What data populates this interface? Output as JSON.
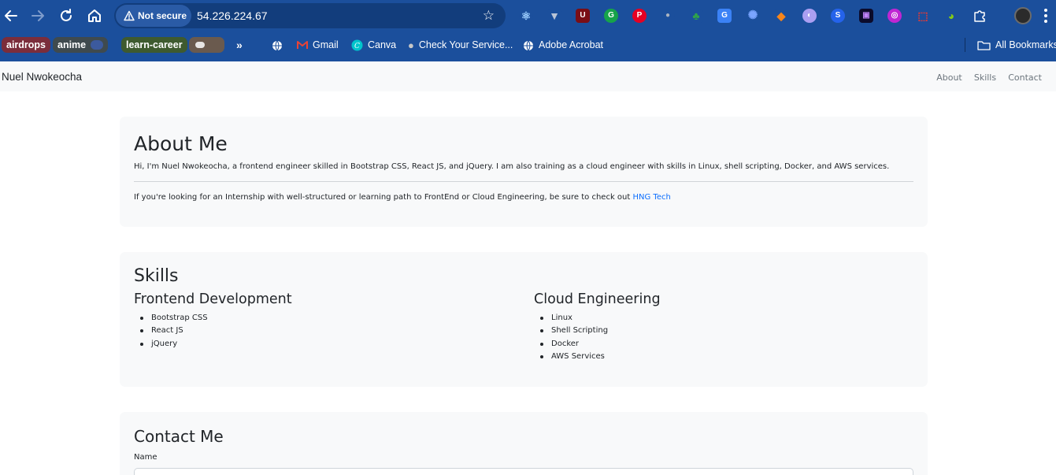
{
  "browser": {
    "address_bar": {
      "security_label": "Not secure",
      "url": "54.226.224.67"
    },
    "extensions": [
      "react-devtools-icon",
      "vuejs-icon",
      "ublock-icon",
      "grammarly-icon",
      "pinterest-icon",
      "rabby-icon",
      "bonsai-icon",
      "google-translate-icon",
      "gear-blue-icon",
      "metamask-icon",
      "phantom-icon",
      "sider-icon",
      "tab-icon",
      "magenta-icon",
      "pdf-icon",
      "earth-icon",
      "puzzle-icon"
    ],
    "bookmarks": [
      {
        "label": "airdrops",
        "type": "folder-chip",
        "color": "#7b2d3b"
      },
      {
        "label": "anime",
        "type": "folder-chip",
        "color": "#3f4a4e"
      },
      {
        "label": "learn-career",
        "type": "folder-chip",
        "color": "#3e5a2f"
      },
      {
        "label": "",
        "type": "folder-chip",
        "color": "#6a5a4e"
      },
      {
        "label": "Gmail",
        "type": "link"
      },
      {
        "label": "Canva",
        "type": "link"
      },
      {
        "label": "Check Your Service...",
        "type": "link"
      },
      {
        "label": "Adobe Acrobat",
        "type": "link"
      },
      {
        "label": "All Bookmarks",
        "type": "folder"
      }
    ]
  },
  "navbar": {
    "brand": "Nuel Nwokeocha",
    "links": [
      "About",
      "Skills",
      "Contact"
    ]
  },
  "about": {
    "title": "About Me",
    "intro": "Hi, I'm Nuel Nwokeocha, a frontend engineer skilled in Bootstrap CSS, React JS, and jQuery. I am also training as a cloud engineer with skills in Linux, shell scripting, Docker, and AWS services.",
    "cta_text": "If you're looking for an Internship with well-structured or learning path to FrontEnd or Cloud Engineering, be sure to check out",
    "cta_link": "HNG Tech"
  },
  "skills": {
    "title": "Skills",
    "groups": [
      {
        "title": "Frontend Development",
        "items": [
          "Bootstrap CSS",
          "React JS",
          "jQuery"
        ]
      },
      {
        "title": "Cloud Engineering",
        "items": [
          "Linux",
          "Shell Scripting",
          "Docker",
          "AWS Services"
        ]
      }
    ]
  },
  "contact": {
    "title": "Contact Me",
    "name_label": "Name",
    "name_value": ""
  },
  "colors": {
    "chrome_bg": "#1b4f9c",
    "omnibox_bg": "#123d7c",
    "card_bg": "#f8f9fa",
    "link": "#0d6efd"
  }
}
